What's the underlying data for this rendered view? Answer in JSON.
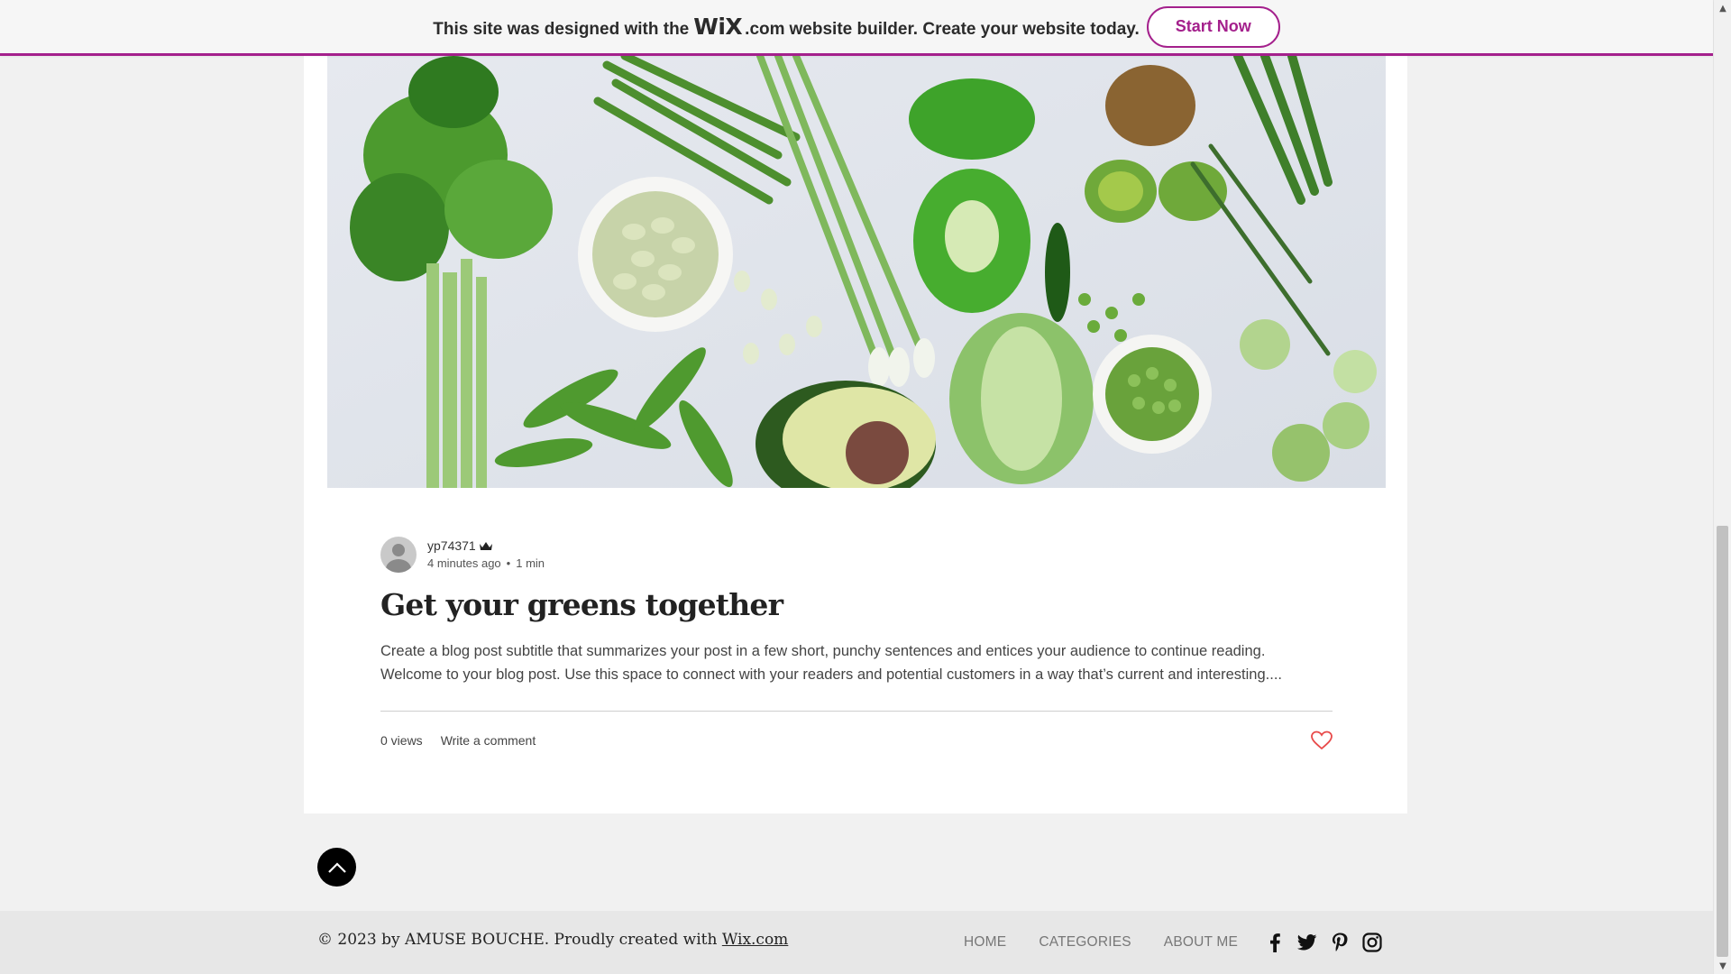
{
  "banner": {
    "text_before": "This site was designed with the",
    "logo": "WiX",
    "logo_suffix": ".com",
    "text_after": "website builder. Create your website today.",
    "cta": "Start Now",
    "accent_color": "#a4208c"
  },
  "post": {
    "author": "yp74371",
    "author_badge_icon": "crown-icon",
    "time_ago": "4 minutes ago",
    "separator": "•",
    "read_time": "1 min",
    "title": "Get your greens together",
    "excerpt_line1": "Create a blog post subtitle that summarizes your post in a few short, punchy sentences and entices your audience to continue reading.",
    "excerpt_line2": "Welcome to your blog post. Use this space to connect with your readers and potential customers in a way that’s current and interesting....",
    "views": "0 views",
    "comment_link": "Write a comment",
    "like_color": "#e84a4a"
  },
  "footer": {
    "copyright_text": "© 2023 by AMUSE BOUCHE. Proudly created with ",
    "copyright_link": "Wix.com",
    "nav": [
      "HOME",
      "CATEGORIES",
      "ABOUT ME"
    ],
    "social": [
      "facebook-icon",
      "twitter-icon",
      "pinterest-icon",
      "instagram-icon"
    ]
  }
}
